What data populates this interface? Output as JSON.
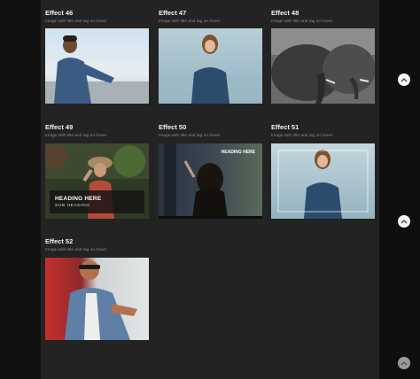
{
  "effects": [
    {
      "title": "Effect 46",
      "subtitle": "Image with title and tag on hover"
    },
    {
      "title": "Effect 47",
      "subtitle": "Image with title and tag on hover"
    },
    {
      "title": "Effect 48",
      "subtitle": "Image with title and tag on hover"
    },
    {
      "title": "Effect 49",
      "subtitle": "Image with title and tag on hover",
      "overlay_heading": "HEADING HERE",
      "overlay_subheading": "SUB HEADING"
    },
    {
      "title": "Effect 50",
      "subtitle": "Image with title and tag on hover",
      "overlay_heading": "HEADING HERE"
    },
    {
      "title": "Effect 51",
      "subtitle": "Image with title and tag on hover"
    },
    {
      "title": "Effect 52",
      "subtitle": "Image with title and tag on hover"
    }
  ],
  "icons": {
    "scroll_up": "chevron-up-icon",
    "back_to_top": "chevron-up-icon"
  }
}
